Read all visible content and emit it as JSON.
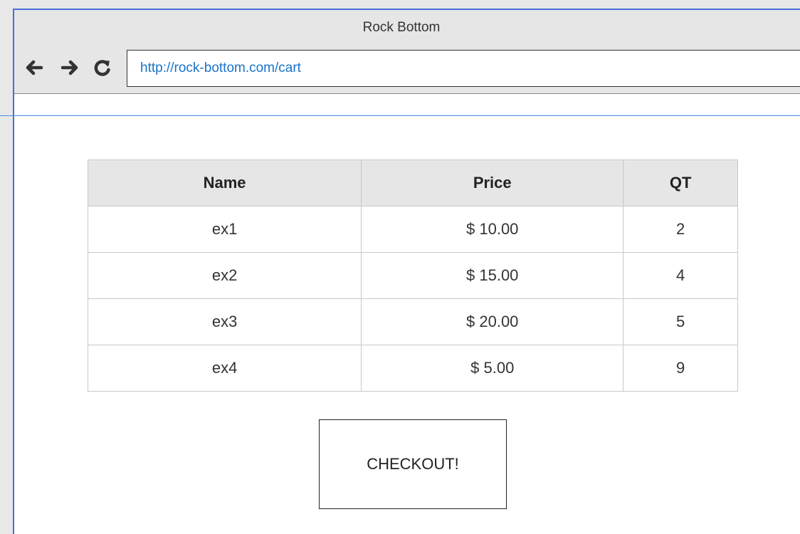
{
  "window": {
    "title": "Rock Bottom"
  },
  "browser": {
    "back_icon": "arrow-left-icon",
    "forward_icon": "arrow-right-icon",
    "reload_icon": "reload-icon",
    "url": "http://rock-bottom.com/cart"
  },
  "cart": {
    "headers": [
      "Name",
      "Price",
      "QT"
    ],
    "rows": [
      [
        "ex1",
        "$ 10.00",
        "2"
      ],
      [
        "ex2",
        "$ 15.00",
        "4"
      ],
      [
        "ex3",
        "$ 20.00",
        "5"
      ],
      [
        "ex4",
        "$ 5.00",
        "9"
      ]
    ]
  },
  "checkout": {
    "label": "CHECKOUT!"
  },
  "colors": {
    "window_border": "#4a6fd9",
    "url_text": "#1a73c8",
    "separator": "#4a90e2"
  }
}
